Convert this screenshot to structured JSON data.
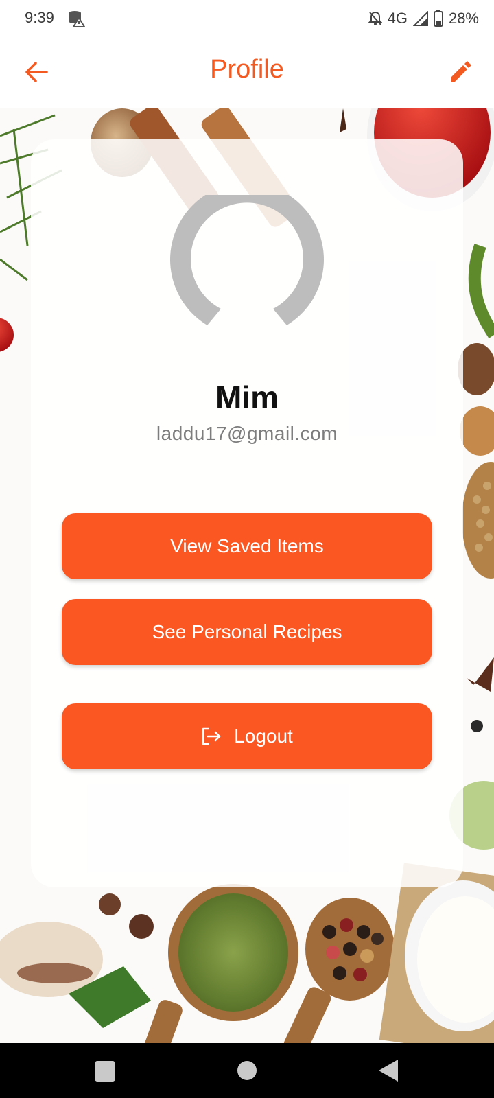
{
  "status_bar": {
    "time": "9:39",
    "network": "4G",
    "battery": "28%",
    "icons": [
      "data-saver-warning-icon",
      "notifications-off-icon",
      "signal-icon",
      "battery-icon"
    ]
  },
  "app_bar": {
    "title": "Profile",
    "back_icon": "arrow-left-icon",
    "edit_icon": "pencil-icon",
    "accent_color": "#f25a22"
  },
  "profile": {
    "name": "Mim",
    "email": "laddu17@gmail.com",
    "avatar_icon": "person-placeholder-icon"
  },
  "actions": {
    "view_saved": "View Saved Items",
    "personal_recipes": "See Personal Recipes",
    "logout": "Logout",
    "logout_icon": "logout-icon",
    "button_color": "#fb5722"
  },
  "nav_bar": {
    "icons": [
      "recents-icon",
      "home-icon",
      "back-icon"
    ]
  }
}
